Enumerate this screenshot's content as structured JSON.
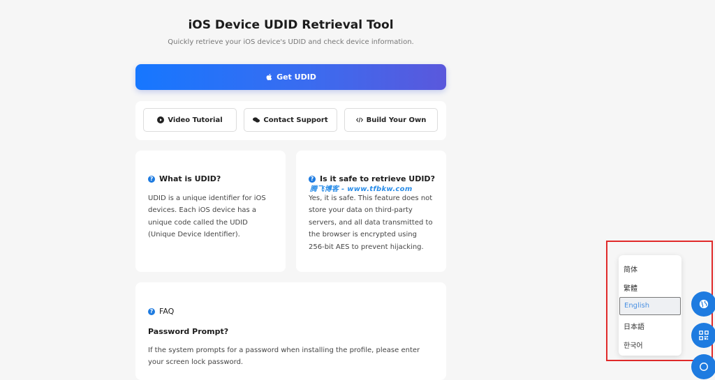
{
  "header": {
    "title": "iOS Device UDID Retrieval Tool",
    "subtitle": "Quickly retrieve your iOS device's UDID and check device information."
  },
  "primary_button": {
    "label": "Get UDID",
    "icon": "apple-icon"
  },
  "links": [
    {
      "label": "Video Tutorial",
      "icon": "play-icon"
    },
    {
      "label": "Contact Support",
      "icon": "chat-icon"
    },
    {
      "label": "Build Your Own",
      "icon": "code-icon"
    }
  ],
  "cards": {
    "what": {
      "title": "What is UDID?",
      "body": "UDID is a unique identifier for iOS devices. Each iOS device has a unique code called the UDID (Unique Device Identifier)."
    },
    "safe": {
      "title": "Is it safe to retrieve UDID?",
      "body": "Yes, it is safe. This feature does not store your data on third-party servers, and all data transmitted to the browser is encrypted using 256-bit AES to prevent hijacking."
    }
  },
  "watermark": "腾飞博客 - www.tfbkw.com",
  "faq": {
    "title": "FAQ",
    "question": "Password Prompt?",
    "answer": "If the system prompts for a password when installing the profile, please enter your screen lock password."
  },
  "language_menu": {
    "items": [
      "简体",
      "繁體",
      "English",
      "日本語",
      "한국어"
    ],
    "selected": "English"
  },
  "floating_buttons": [
    "globe-icon",
    "qr-code-icon",
    "share-icon"
  ],
  "colors": {
    "accent": "#1677ff",
    "accent_end": "#5a58dc",
    "icon_blue": "#1e7be0",
    "highlight_border": "#e02a2a",
    "background": "#f6f6f6"
  }
}
